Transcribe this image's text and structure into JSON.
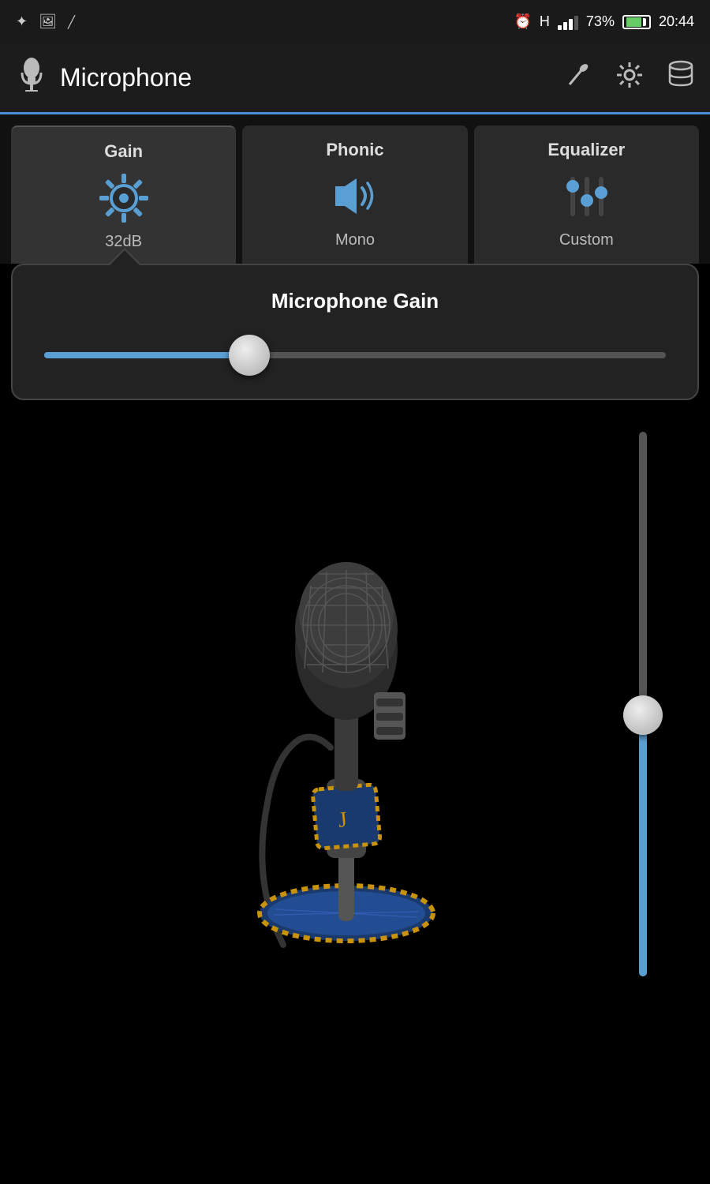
{
  "statusBar": {
    "leftIcons": [
      "camera-icon",
      "image-icon",
      "flash-icon"
    ],
    "clock_icon": "⏰",
    "signal": "H",
    "battery_pct": "73%",
    "time": "20:44"
  },
  "appBar": {
    "icon": "🎤",
    "title": "Microphone",
    "actions": {
      "mic_action_label": "🎤",
      "settings_label": "⚙",
      "database_label": "🗄"
    }
  },
  "tabs": [
    {
      "id": "gain",
      "label_top": "Gain",
      "label_bottom": "32dB",
      "active": true
    },
    {
      "id": "phonic",
      "label_top": "Phonic",
      "label_bottom": "Mono",
      "active": false
    },
    {
      "id": "equalizer",
      "label_top": "Equalizer",
      "label_bottom": "Custom",
      "active": false
    }
  ],
  "gainPanel": {
    "title": "Microphone Gain",
    "sliderValue": 32,
    "sliderPercent": 33
  },
  "verticalSlider": {
    "value": 52
  },
  "colors": {
    "accent": "#5a9fd4",
    "background": "#000000",
    "surface": "#222222",
    "tabActive": "#333333",
    "text": "#ffffff"
  }
}
